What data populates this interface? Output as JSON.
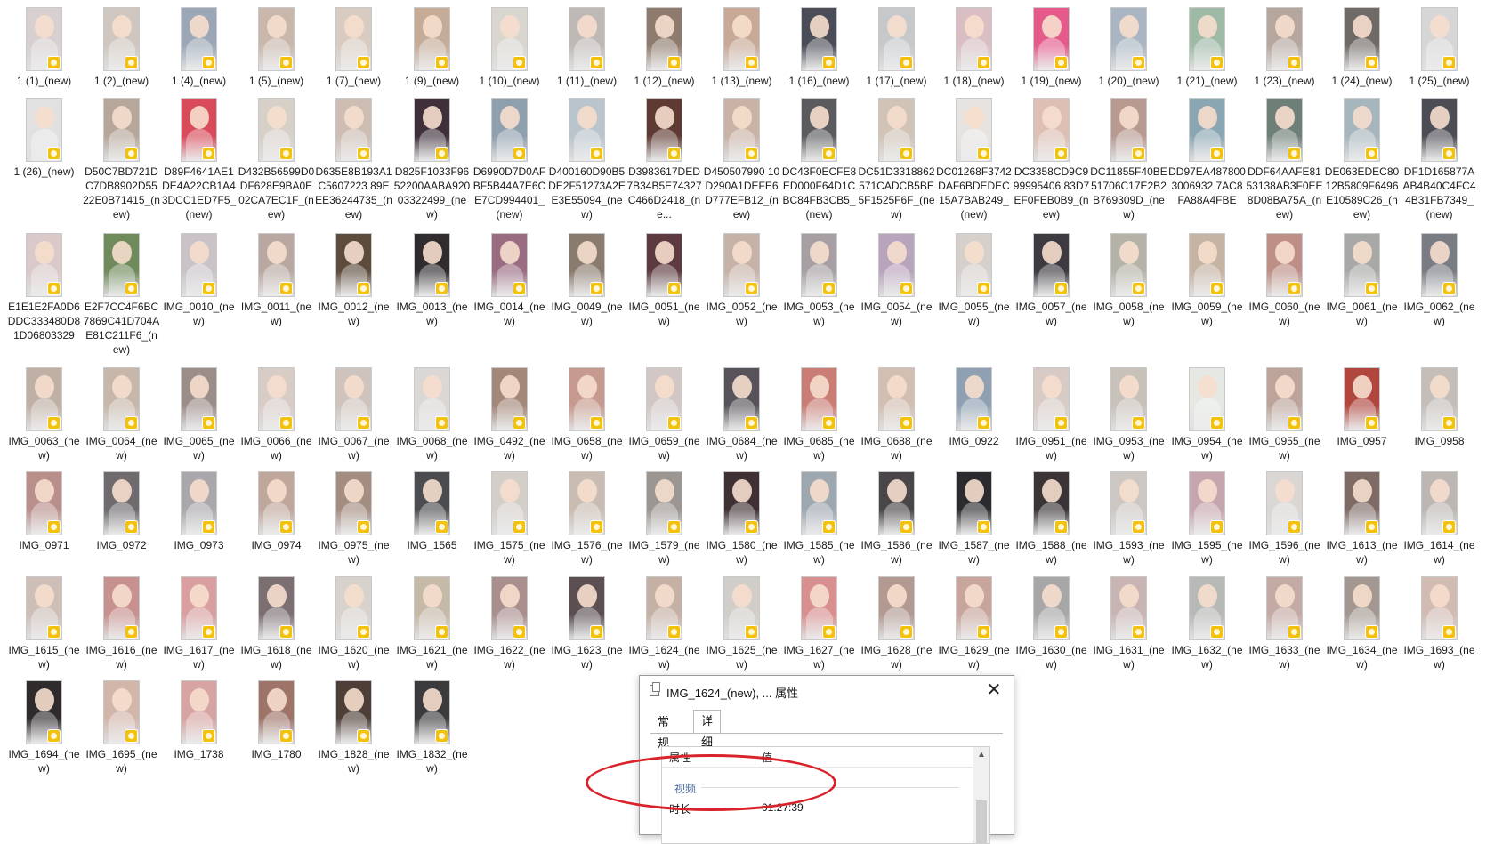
{
  "files": [
    [
      {
        "name": "1 (1)_(new)",
        "bg": "#d7cfd0"
      },
      {
        "name": "1 (2)_(new)",
        "bg": "#cfc7bf"
      },
      {
        "name": "1 (4)_(new)",
        "bg": "#9ba7b6"
      },
      {
        "name": "1 (5)_(new)",
        "bg": "#c9b7ab"
      },
      {
        "name": "1 (7)_(new)",
        "bg": "#d8cbc1"
      },
      {
        "name": "1 (9)_(new)",
        "bg": "#c4ac99"
      },
      {
        "name": "1 (10)_(new)",
        "bg": "#d9d6cf"
      },
      {
        "name": "1 (11)_(new)",
        "bg": "#bfb9b6"
      },
      {
        "name": "1 (12)_(new)",
        "bg": "#8e7b6d"
      },
      {
        "name": "1 (13)_(new)",
        "bg": "#c8a896"
      },
      {
        "name": "1 (16)_(new)",
        "bg": "#4a4d57"
      },
      {
        "name": "1 (17)_(new)",
        "bg": "#c5c9cc"
      },
      {
        "name": "1 (18)_(new)",
        "bg": "#d9bfc3"
      },
      {
        "name": "1 (19)_(new)",
        "bg": "#e45a8a"
      },
      {
        "name": "1 (20)_(new)",
        "bg": "#a9b5c2"
      },
      {
        "name": "1 (21)_(new)",
        "bg": "#9fb9a7"
      },
      {
        "name": "1 (23)_(new)",
        "bg": "#b6a79e"
      },
      {
        "name": "1 (24)_(new)",
        "bg": "#6f6a66"
      },
      {
        "name": "1 (25)_(new)",
        "bg": "#d6d6d6"
      }
    ],
    [
      {
        "name": "1 (26)_(new)",
        "bg": "#e1e1e1"
      },
      {
        "name": "D50C7BD721DC7DB8902D5522E0B71415_(new)",
        "bg": "#b7a79b"
      },
      {
        "name": "D89F4641AE1DE4A22CB1A43DCC1ED7F5_(new)",
        "bg": "#d94a5b"
      },
      {
        "name": "D432B56599D0DF628E9BA0E02CA7EC1F_(new)",
        "bg": "#d7d0c9"
      },
      {
        "name": "D635E8B193A1C5607223 89EEE36244735_(new)",
        "bg": "#cdbdb3"
      },
      {
        "name": "D825F1033F9652200AABA92003322499_(new)",
        "bg": "#3e2f3a"
      },
      {
        "name": "D6990D7D0AFBF5B44A7E6CE7CD994401_(new)",
        "bg": "#8e9fae"
      },
      {
        "name": "D400160D90B5DE2F51273A2EE3E55094_(new)",
        "bg": "#b9c4cc"
      },
      {
        "name": "D3983617DED7B34B5E74327C466D2418_(ne...",
        "bg": "#5f3a32"
      },
      {
        "name": "D450507990 10D290A1DEFE6D777EFB12_(new)",
        "bg": "#c9b2a6"
      },
      {
        "name": "DC43F0ECFE8ED000F64D1CBC84FB3CB5_(new)",
        "bg": "#5b5b5f"
      },
      {
        "name": "DC51D3318862571CADCB5BE5F1525F6F_(new)",
        "bg": "#d1c3b6"
      },
      {
        "name": "DC01268F3742DAF6BDEDEC15A7BAB249_(new)",
        "bg": "#e6e3e1"
      },
      {
        "name": "DC3358CD9C999995406 83D7EF0FEB0B9_(new)",
        "bg": "#ddbfb4"
      },
      {
        "name": "DC11855F40BE51706C17E2B2B769309D_(new)",
        "bg": "#b89a91"
      },
      {
        "name": "DD97EA4878003006932 7AC8FA88A4FBE",
        "bg": "#8aa6b3"
      },
      {
        "name": "DDF64AAFE8153138AB3F0EE8D08BA75A_(new)",
        "bg": "#6e7f77"
      },
      {
        "name": "DE063EDEC8012B5809F6496E10589C26_(new)",
        "bg": "#a7b5bd"
      },
      {
        "name": "DF1D165877AAB4B40C4FC44B31FB7349_(new)",
        "bg": "#4c4c55"
      }
    ],
    [
      {
        "name": "E1E1E2FA0D6DDC333480D81D06803329",
        "bg": "#d9c9c9"
      },
      {
        "name": "E2F7CC4F6BC7869C41D704AE81C211F6_(new)",
        "bg": "#6f8a5b"
      },
      {
        "name": "IMG_0010_(new)",
        "bg": "#c9c3c8"
      },
      {
        "name": "IMG_0011_(new)",
        "bg": "#b9a8a1"
      },
      {
        "name": "IMG_0012_(new)",
        "bg": "#5d4c3c"
      },
      {
        "name": "IMG_0013_(new)",
        "bg": "#2f2b2f"
      },
      {
        "name": "IMG_0014_(new)",
        "bg": "#9a6c82"
      },
      {
        "name": "IMG_0049_(new)",
        "bg": "#8a7b6f"
      },
      {
        "name": "IMG_0051_(new)",
        "bg": "#5c3a3f"
      },
      {
        "name": "IMG_0052_(new)",
        "bg": "#c7b2a8"
      },
      {
        "name": "IMG_0053_(new)",
        "bg": "#a69fa3"
      },
      {
        "name": "IMG_0054_(new)",
        "bg": "#b8a4bd"
      },
      {
        "name": "IMG_0055_(new)",
        "bg": "#d6d0cc"
      },
      {
        "name": "IMG_0057_(new)",
        "bg": "#3d3a40"
      },
      {
        "name": "IMG_0058_(new)",
        "bg": "#b5b3a8"
      },
      {
        "name": "IMG_0059_(new)",
        "bg": "#c5b3a4"
      },
      {
        "name": "IMG_0060_(new)",
        "bg": "#bd8f86"
      },
      {
        "name": "IMG_0061_(new)",
        "bg": "#a8a9a6"
      },
      {
        "name": "IMG_0062_(new)",
        "bg": "#7a7c84"
      }
    ],
    [
      {
        "name": "IMG_0063_(new)",
        "bg": "#bfb0a5"
      },
      {
        "name": "IMG_0064_(new)",
        "bg": "#c7b7aa"
      },
      {
        "name": "IMG_0065_(new)",
        "bg": "#9b8d89"
      },
      {
        "name": "IMG_0066_(new)",
        "bg": "#d8ccc7"
      },
      {
        "name": "IMG_0067_(new)",
        "bg": "#cfc4bd"
      },
      {
        "name": "IMG_0068_(new)",
        "bg": "#dad7d4"
      },
      {
        "name": "IMG_0492_(new)",
        "bg": "#a38778"
      },
      {
        "name": "IMG_0658_(new)",
        "bg": "#c69a8e"
      },
      {
        "name": "IMG_0659_(new)",
        "bg": "#d1c7c4"
      },
      {
        "name": "IMG_0684_(new)",
        "bg": "#58535a"
      },
      {
        "name": "IMG_0685_(new)",
        "bg": "#c97d75"
      },
      {
        "name": "IMG_0688_(new)",
        "bg": "#d2bfb2"
      },
      {
        "name": "IMG_0922",
        "bg": "#8fa0b2"
      },
      {
        "name": "IMG_0951_(new)",
        "bg": "#d8cbc6"
      },
      {
        "name": "IMG_0953_(new)",
        "bg": "#c8c1ba"
      },
      {
        "name": "IMG_0954_(new)",
        "bg": "#e5e8e3"
      },
      {
        "name": "IMG_0955_(new)",
        "bg": "#bca49a"
      },
      {
        "name": "IMG_0957",
        "bg": "#b0463e"
      },
      {
        "name": "IMG_0958",
        "bg": "#c4bdb8"
      }
    ],
    [
      {
        "name": "IMG_0971",
        "bg": "#b98f8b"
      },
      {
        "name": "IMG_0972",
        "bg": "#6e6a6e"
      },
      {
        "name": "IMG_0973",
        "bg": "#a9a7ab"
      },
      {
        "name": "IMG_0974",
        "bg": "#c0a79b"
      },
      {
        "name": "IMG_0975_(new)",
        "bg": "#a38d81"
      },
      {
        "name": "IMG_1565",
        "bg": "#4b4c4f"
      },
      {
        "name": "IMG_1575_(new)",
        "bg": "#d4cec9"
      },
      {
        "name": "IMG_1576_(new)",
        "bg": "#c9bcb2"
      },
      {
        "name": "IMG_1579_(new)",
        "bg": "#9c9692"
      },
      {
        "name": "IMG_1580_(new)",
        "bg": "#3f3033"
      },
      {
        "name": "IMG_1585_(new)",
        "bg": "#9da7b0"
      },
      {
        "name": "IMG_1586_(new)",
        "bg": "#4a4548"
      },
      {
        "name": "IMG_1587_(new)",
        "bg": "#2b2a2e"
      },
      {
        "name": "IMG_1588_(new)",
        "bg": "#3a3436"
      },
      {
        "name": "IMG_1593_(new)",
        "bg": "#cdc7c4"
      },
      {
        "name": "IMG_1595_(new)",
        "bg": "#c6a6ae"
      },
      {
        "name": "IMG_1596_(new)",
        "bg": "#d9d6d4"
      },
      {
        "name": "IMG_1613_(new)",
        "bg": "#7e6b66"
      },
      {
        "name": "IMG_1614_(new)",
        "bg": "#bcb7b3"
      }
    ],
    [
      {
        "name": "IMG_1615_(new)",
        "bg": "#cdbfb8"
      },
      {
        "name": "IMG_1616_(new)",
        "bg": "#c7918f"
      },
      {
        "name": "IMG_1617_(new)",
        "bg": "#d99fa0"
      },
      {
        "name": "IMG_1618_(new)",
        "bg": "#7c6f72"
      },
      {
        "name": "IMG_1620_(new)",
        "bg": "#d8d2cc"
      },
      {
        "name": "IMG_1621_(new)",
        "bg": "#c5b9a8"
      },
      {
        "name": "IMG_1622_(new)",
        "bg": "#a88e8d"
      },
      {
        "name": "IMG_1623_(new)",
        "bg": "#5b4f52"
      },
      {
        "name": "IMG_1624_(new)",
        "bg": "#c4b0a4"
      },
      {
        "name": "IMG_1625_(new)",
        "bg": "#d1cdc8"
      },
      {
        "name": "IMG_1627_(new)",
        "bg": "#d88f8f"
      },
      {
        "name": "IMG_1628_(new)",
        "bg": "#b29a93"
      },
      {
        "name": "IMG_1629_(new)",
        "bg": "#c7a59c"
      },
      {
        "name": "IMG_1630_(new)",
        "bg": "#a7a7a7"
      },
      {
        "name": "IMG_1631_(new)",
        "bg": "#c8b5b3"
      },
      {
        "name": "IMG_1632_(new)",
        "bg": "#b7b9b6"
      },
      {
        "name": "IMG_1633_(new)",
        "bg": "#c4aaa4"
      },
      {
        "name": "IMG_1634_(new)",
        "bg": "#a39891"
      },
      {
        "name": "IMG_1693_(new)",
        "bg": "#d1bbb3"
      }
    ],
    [
      {
        "name": "IMG_1694_(new)",
        "bg": "#2f2a2c"
      },
      {
        "name": "IMG_1695_(new)",
        "bg": "#d2b6aa"
      },
      {
        "name": "IMG_1738",
        "bg": "#d6a4a2"
      },
      {
        "name": "IMG_1780",
        "bg": "#9e7469"
      },
      {
        "name": "IMG_1828_(new)",
        "bg": "#4d3e38"
      },
      {
        "name": "IMG_1832_(new)",
        "bg": "#3b3a3c"
      }
    ]
  ],
  "dialog": {
    "title": "IMG_1624_(new), ... 属性",
    "close_glyph": "✕",
    "tabs": [
      "常规",
      "详细信息"
    ],
    "active_tab": "详细信息",
    "columns": {
      "property": "属性",
      "value": "值"
    },
    "group": "视频",
    "rows": [
      {
        "name": "时长",
        "value": "01:27:39"
      }
    ],
    "scroll_up_glyph": "▲"
  },
  "colors": {
    "badge": "#f4c20d",
    "annotation": "#d8232a"
  }
}
